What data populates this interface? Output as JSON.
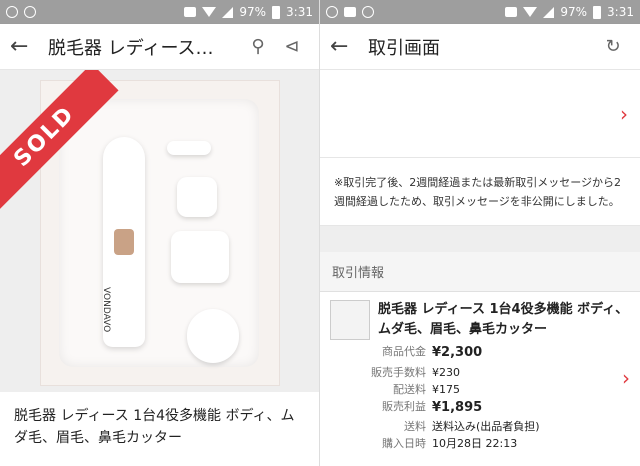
{
  "status": {
    "battery": "97%",
    "time": "3:31"
  },
  "left": {
    "title": "脱毛器 レディース…",
    "sold_badge": "SOLD",
    "brand_on_device": "VONDAVO",
    "product_title": "脱毛器 レディース 1台4役多機能 ボディ、ムダ毛、眉毛、鼻毛カッター"
  },
  "right": {
    "title": "取引画面",
    "note": "※取引完了後、2週間経過または最新取引メッセージから2週間経過したため、取引メッセージを非公開にしました。",
    "section_header": "取引情報",
    "item_name": "脱毛器 レディース 1台4役多機能 ボディ、ムダ毛、眉毛、鼻毛カッター",
    "rows": [
      {
        "k": "商品代金",
        "v": "¥2,300"
      },
      {
        "k": "販売手数料",
        "v": "¥230"
      },
      {
        "k": "配送料",
        "v": "¥175"
      },
      {
        "k": "販売利益",
        "v": "¥1,895"
      },
      {
        "k": "送料",
        "v": "送料込み(出品者負担)"
      },
      {
        "k": "購入日時",
        "v": "10月28日 22:13"
      }
    ]
  },
  "colors": {
    "accent": "#e0393f"
  },
  "icons": {
    "back": "arrow-left-icon",
    "search": "search-icon",
    "share": "share-icon",
    "refresh": "refresh-icon"
  }
}
